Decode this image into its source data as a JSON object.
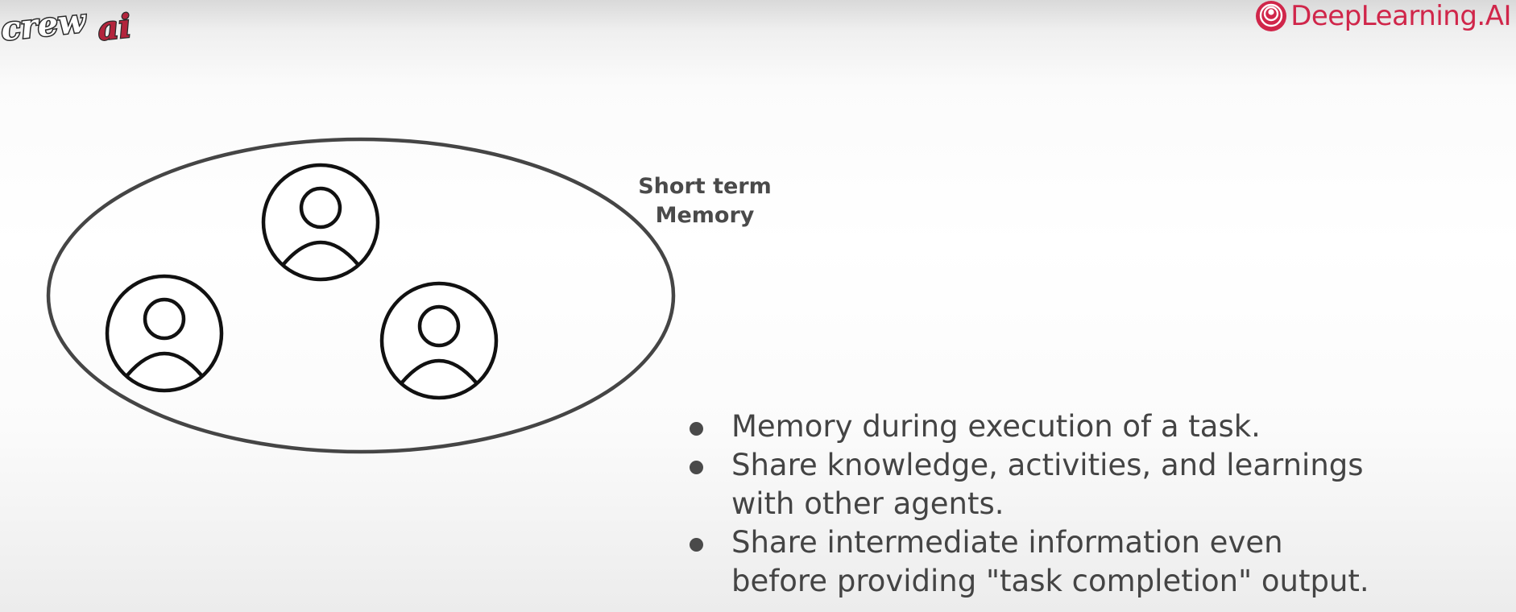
{
  "branding": {
    "left_logo": "crewai",
    "left_logo_parts": [
      "crew",
      "ai"
    ],
    "right_logo": "DeepLearning.AI",
    "right_logo_icon": "deeplearning-ai-logo-icon",
    "colors": {
      "crew_accent": "#b3243c",
      "deeplearning_red": "#d0264a"
    }
  },
  "diagram": {
    "group_shape": "ellipse",
    "label_lines": [
      "Short term",
      "Memory"
    ],
    "agents": [
      {
        "icon": "user-icon"
      },
      {
        "icon": "user-icon"
      },
      {
        "icon": "user-icon"
      }
    ]
  },
  "bullets": [
    {
      "lines": [
        "Memory during execution of a task."
      ]
    },
    {
      "lines": [
        "Share knowledge, activities, and learnings",
        "with other agents."
      ]
    },
    {
      "lines": [
        "Share intermediate information even",
        "before providing \"task completion\" output."
      ]
    }
  ]
}
